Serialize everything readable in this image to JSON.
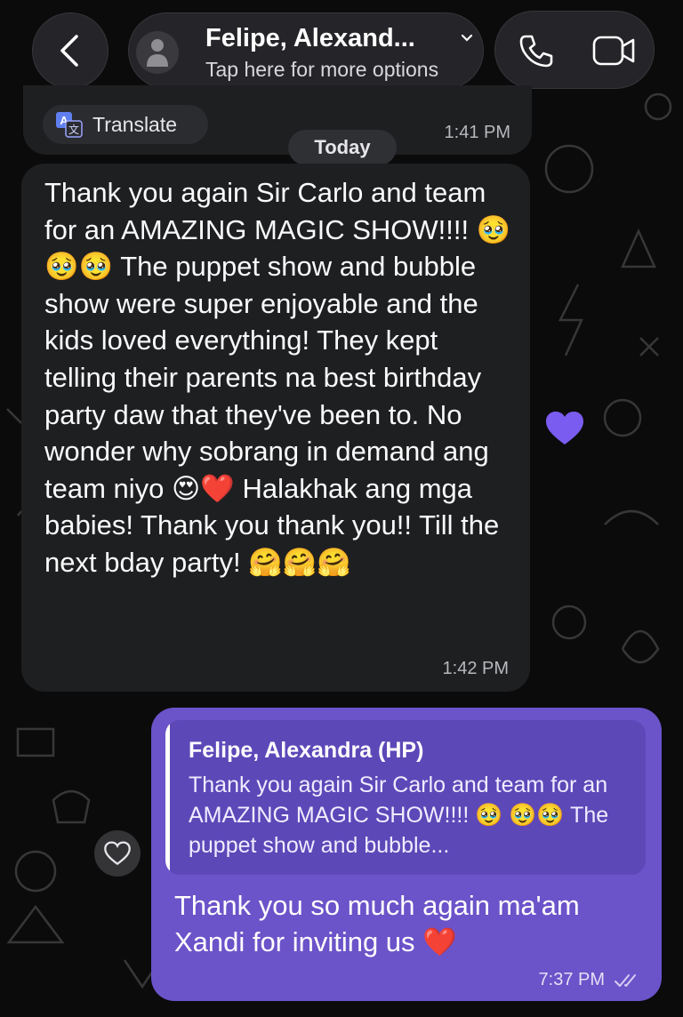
{
  "header": {
    "title": "Felipe, Alexand...",
    "subtitle": "Tap here for more options"
  },
  "icons": {
    "back": "chevron-left-icon",
    "avatar": "person-icon",
    "dropdown": "chevron-down-icon",
    "call": "phone-icon",
    "video": "video-camera-icon",
    "translate": "translate-icon",
    "reaction": "heart-icon",
    "read_status": "double-check-icon"
  },
  "previous_message": {
    "translate_label": "Translate",
    "time": "1:41 PM"
  },
  "date_separator": "Today",
  "incoming_message": {
    "text": "Thank you again Sir Carlo and team for an AMAZING MAGIC SHOW!!!! 🥹🥹🥹 The puppet show and bubble show were super enjoyable and the kids loved everything! They kept telling their parents na best birthday party daw that they've been to. No wonder why sobrang in demand ang team niyo 😍❤️ Halakhak ang mga babies! Thank you thank you!! Till the next bday party! 🤗🤗🤗",
    "time": "1:42 PM",
    "reaction": "purple heart"
  },
  "outgoing_message": {
    "quoted_author": "Felipe, Alexandra (HP)",
    "quoted_text": "Thank you again Sir Carlo and team for an AMAZING MAGIC SHOW!!!! 🥹 🥹🥹 The puppet show and bubble...",
    "text": "Thank you so much again ma'am Xandi for inviting us ❤️",
    "time": "7:37 PM"
  },
  "colors": {
    "background": "#0b0b0c",
    "incoming_bubble": "#1e1f21",
    "outgoing_bubble": "#6b53c9",
    "quote_box": "#5d48b8",
    "reaction_heart": "#7b5cf0"
  }
}
